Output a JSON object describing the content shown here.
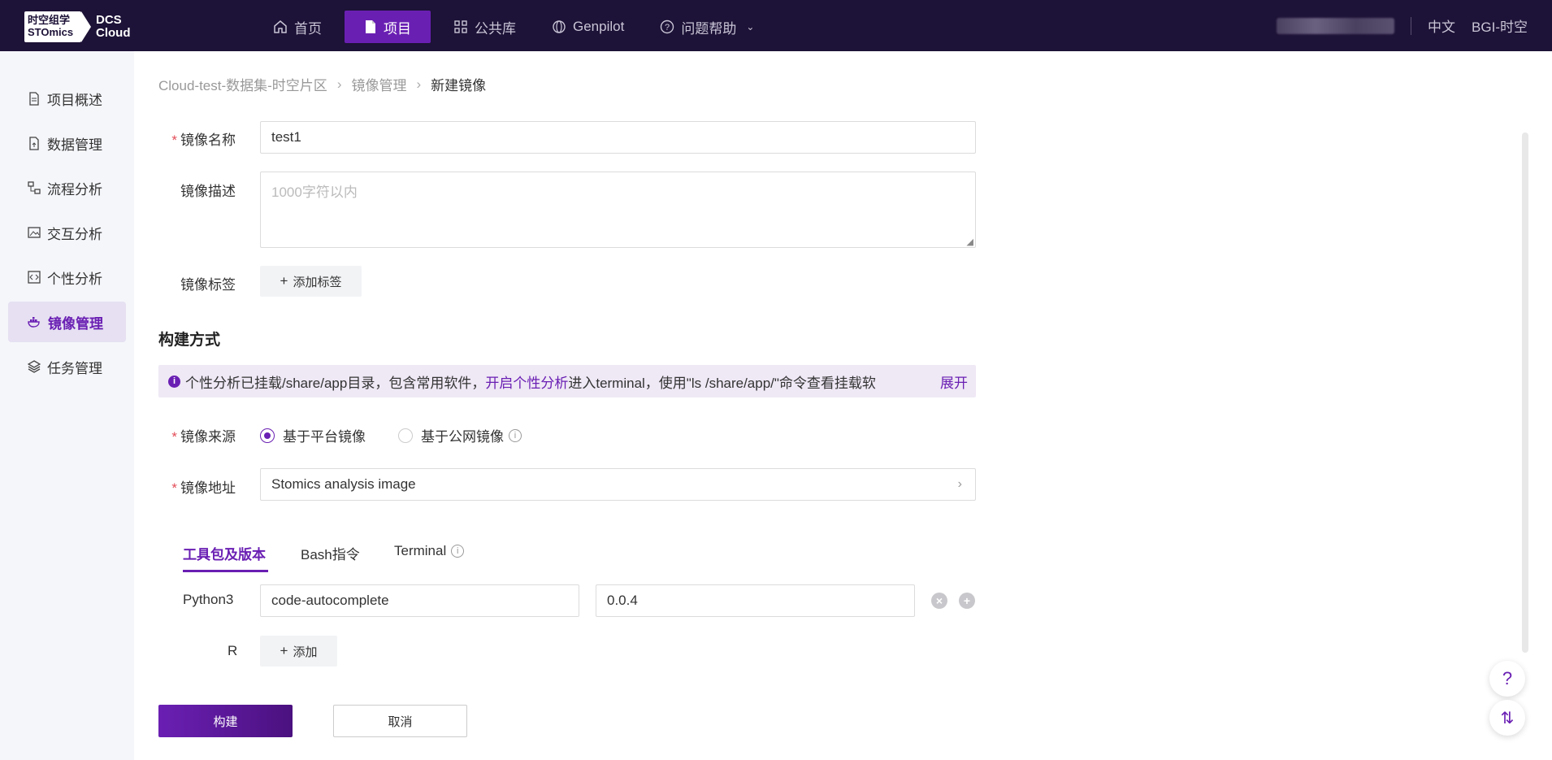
{
  "brand": {
    "logo_line1": "时空组学",
    "logo_line2": "STOmics",
    "product_line1": "DCS",
    "product_line2": "Cloud"
  },
  "nav": {
    "items": [
      {
        "label": "首页",
        "icon": "home-icon"
      },
      {
        "label": "项目",
        "icon": "document-icon"
      },
      {
        "label": "公共库",
        "icon": "grid-icon"
      },
      {
        "label": "Genpilot",
        "icon": "globe-icon"
      },
      {
        "label": "问题帮助",
        "icon": "help-icon"
      }
    ]
  },
  "topright": {
    "language": "中文",
    "org": "BGI-时空"
  },
  "sidebar": {
    "items": [
      {
        "label": "项目概述",
        "icon": "file-icon"
      },
      {
        "label": "数据管理",
        "icon": "file-upload-icon"
      },
      {
        "label": "流程分析",
        "icon": "flow-icon"
      },
      {
        "label": "交互分析",
        "icon": "image-icon"
      },
      {
        "label": "个性分析",
        "icon": "code-icon"
      },
      {
        "label": "镜像管理",
        "icon": "docker-icon"
      },
      {
        "label": "任务管理",
        "icon": "layers-icon"
      }
    ],
    "active_index": 5
  },
  "breadcrumb": {
    "items": [
      "Cloud-test-数据集-时空片区",
      "镜像管理",
      "新建镜像"
    ]
  },
  "form": {
    "name_label": "镜像名称",
    "name_value": "test1",
    "desc_label": "镜像描述",
    "desc_placeholder": "1000字符以内",
    "tag_label": "镜像标签",
    "add_tag_button": "添加标签"
  },
  "build": {
    "section_title": "构建方式",
    "info_text_1": "个性分析已挂载/share/app目录，包含常用软件，",
    "info_link": "开启个性分析",
    "info_text_2": "进入terminal，使用\"ls /share/app/\"命令查看挂载软",
    "info_expand": "展开",
    "source_label": "镜像来源",
    "source_option_platform": "基于平台镜像",
    "source_option_public": "基于公网镜像",
    "address_label": "镜像地址",
    "address_value": "Stomics analysis image"
  },
  "tabs": {
    "items": [
      "工具包及版本",
      "Bash指令",
      "Terminal"
    ],
    "active_index": 0
  },
  "toolkit": {
    "python_label": "Python3",
    "python_package": "code-autocomplete",
    "python_version": "0.0.4",
    "r_label": "R",
    "add_button": "添加"
  },
  "actions": {
    "build_button": "构建",
    "cancel_button": "取消"
  },
  "colors": {
    "primary": "#6a1fb3",
    "topbar": "#1d1237",
    "required": "#e34d59"
  }
}
